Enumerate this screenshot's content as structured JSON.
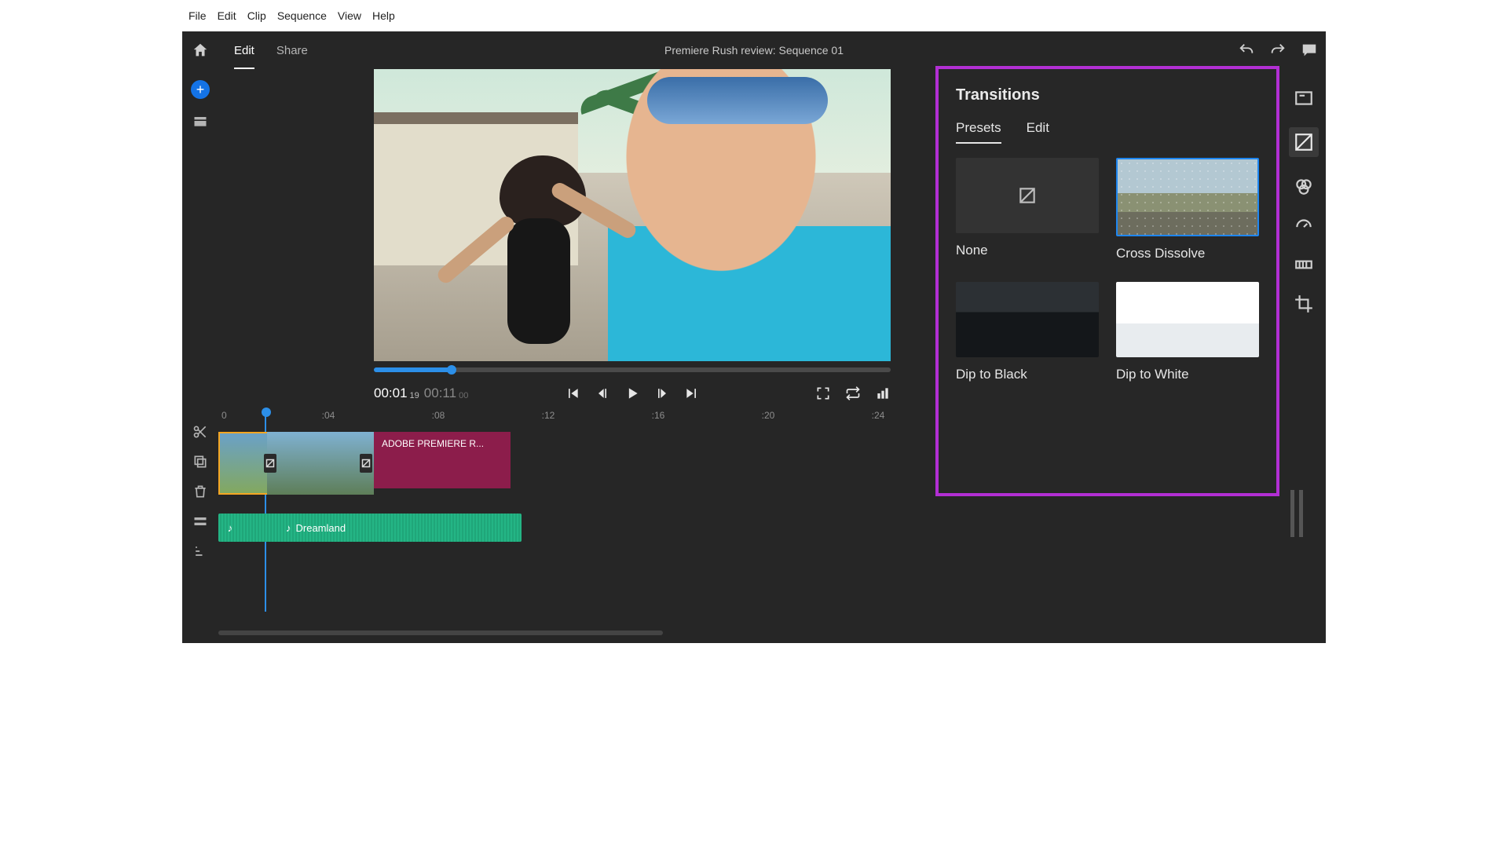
{
  "os_menu": [
    "File",
    "Edit",
    "Clip",
    "Sequence",
    "View",
    "Help"
  ],
  "header": {
    "tabs": {
      "edit": "Edit",
      "share": "Share"
    },
    "title": "Premiere Rush review: Sequence 01"
  },
  "playback": {
    "current": "00:01",
    "current_frames": "19",
    "duration": "00:11",
    "duration_frames": "00"
  },
  "ruler": {
    "t0": "0",
    "marks": [
      ":04",
      ":08",
      ":12",
      ":16",
      ":20",
      ":24"
    ]
  },
  "timeline": {
    "title_clip": "ADOBE PREMIERE R...",
    "audio_clip": "Dreamland"
  },
  "panel": {
    "title": "Transitions",
    "tabs": {
      "presets": "Presets",
      "edit": "Edit"
    },
    "items": {
      "none": "None",
      "cross_dissolve": "Cross Dissolve",
      "dip_black": "Dip to Black",
      "dip_white": "Dip to White"
    }
  },
  "right_rail": [
    "titles",
    "transitions",
    "color",
    "speed",
    "audio",
    "crop"
  ]
}
